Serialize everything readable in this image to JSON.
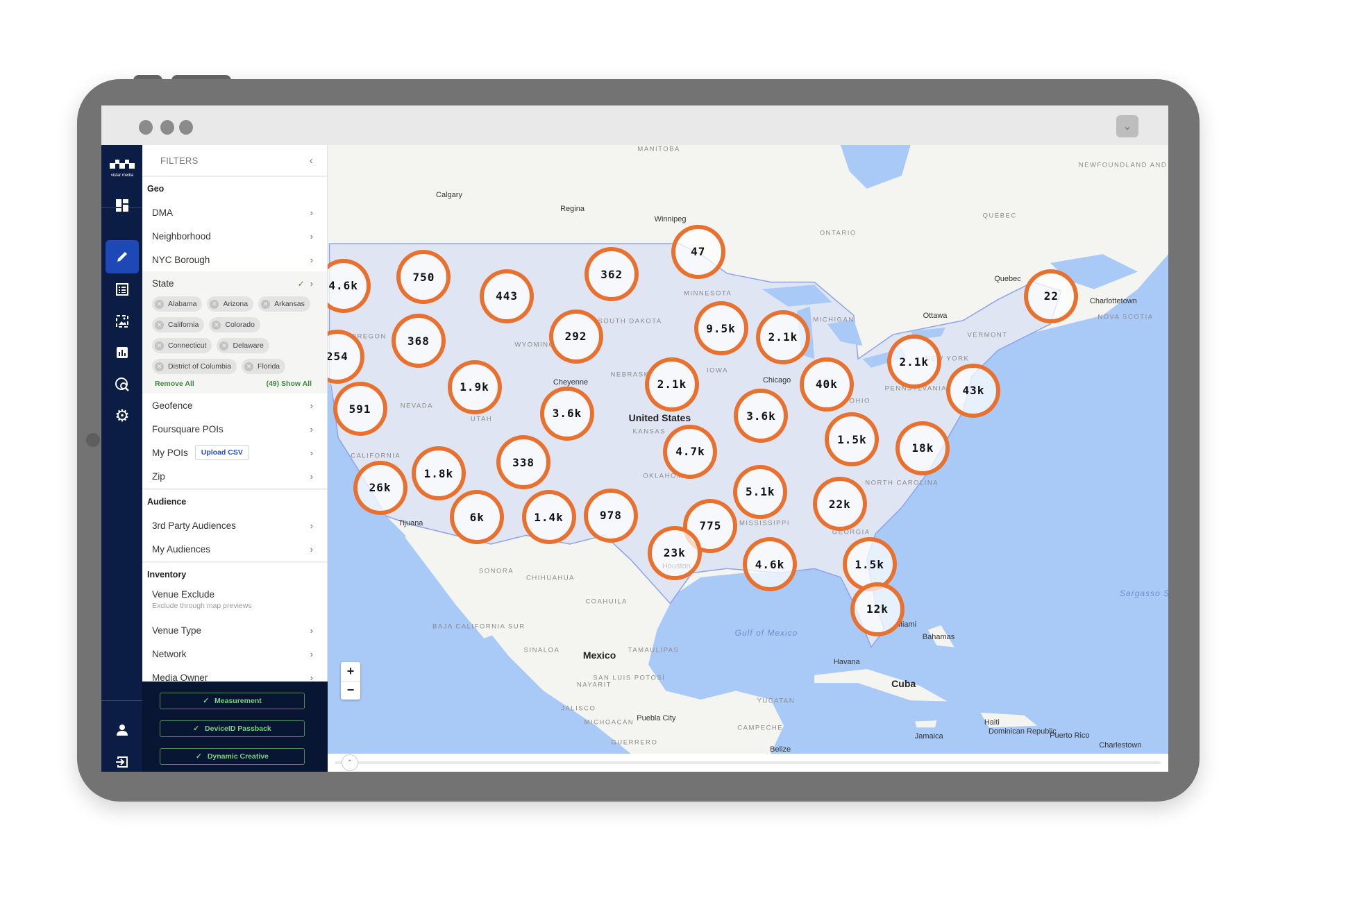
{
  "brand": {
    "logo_text": "vistar media"
  },
  "window": {
    "dropdown_icon": "chevron-down-icon"
  },
  "nav": {
    "items": [
      "dashboard-icon",
      "pencil-icon",
      "list-icon",
      "image-icon",
      "bar-chart-icon",
      "globe-search-icon",
      "gear-icon"
    ],
    "bottom": [
      "user-icon",
      "logout-icon"
    ],
    "active": "pencil-icon"
  },
  "filters": {
    "title": "FILTERS",
    "geo": {
      "heading": "Geo",
      "items": [
        "DMA",
        "Neighborhood",
        "NYC Borough"
      ],
      "state": {
        "label": "State",
        "checked": true,
        "chips": [
          "Alabama",
          "Arizona",
          "Arkansas",
          "California",
          "Colorado",
          "Connecticut",
          "Delaware",
          "District of Columbia",
          "Florida"
        ],
        "remove_all": "Remove All",
        "show_all": "(49) Show All"
      },
      "items2": [
        "Geofence",
        "Foursquare POIs"
      ],
      "my_pois": "My POIs",
      "upload_csv": "Upload CSV",
      "zip": "Zip"
    },
    "audience": {
      "heading": "Audience",
      "items": [
        "3rd Party Audiences",
        "My Audiences"
      ]
    },
    "inventory": {
      "heading": "Inventory",
      "venue_exclude": "Venue Exclude",
      "venue_exclude_sub": "Exclude through map previews",
      "items": [
        "Venue Type",
        "Network",
        "Media Owner"
      ]
    }
  },
  "footer_buttons": [
    "Measurement",
    "DeviceID Passback",
    "Dynamic Creative"
  ],
  "map": {
    "zoom_in": "+",
    "zoom_out": "−",
    "cluster_color": "#e9712f",
    "clusters": [
      "4.6k",
      "750",
      "443",
      "362",
      "47",
      "22",
      "368",
      "292",
      "9.5k",
      "2.1k",
      "254",
      "1.9k",
      "2.1k",
      "40k",
      "2.1k",
      "43k",
      "591",
      "3.6k",
      "3.6k",
      "1.5k",
      "18k",
      "4.7k",
      "338",
      "1.8k",
      "26k",
      "5.1k",
      "22k",
      "6k",
      "1.4k",
      "978",
      "775",
      "23k",
      "4.6k",
      "1.5k",
      "12k"
    ],
    "labels": [
      "MANITOBA",
      "ONTARIO",
      "QUÉBEC",
      "NEWFOUNDLAND AND LABRADOR",
      "Calgary",
      "Regina",
      "Winnipeg",
      "Ottawa",
      "Quebec",
      "Charlottetown",
      "NOVA SCOTIA",
      "United States",
      "Chicago",
      "Cheyenne",
      "NEVADA",
      "UTAH",
      "OREGON",
      "WYOMING",
      "SOUTH DAKOTA",
      "NEBRASKA",
      "KANSAS",
      "IOWA",
      "MINNESOTA",
      "MICHIGAN",
      "PENNSYLVANIA",
      "NEW YORK",
      "VERMONT",
      "OHIO",
      "NORTH CAROLINA",
      "GEORGIA",
      "MISSISSIPPI",
      "OKLAHOMA",
      "CALIFORNIA",
      "Tijuana",
      "SONORA",
      "CHIHUAHUA",
      "COAHUILA",
      "BAJA CALIFORNIA SUR",
      "SINALOA",
      "TAMAULIPAS",
      "Mexico",
      "NAYARIT",
      "JALISCO",
      "MICHOACÁN",
      "GUERRERO",
      "SAN LUIS POTOSÍ",
      "Puebla City",
      "YUCATAN",
      "CAMPECHE",
      "Belize",
      "Havana",
      "Cuba",
      "Bahamas",
      "Jamaica",
      "Haiti",
      "Dominican Republic",
      "Puerto Rico",
      "Charlestown",
      "Gulf of Mexico",
      "Sargasso Sea",
      "Miami",
      "Houston"
    ]
  }
}
